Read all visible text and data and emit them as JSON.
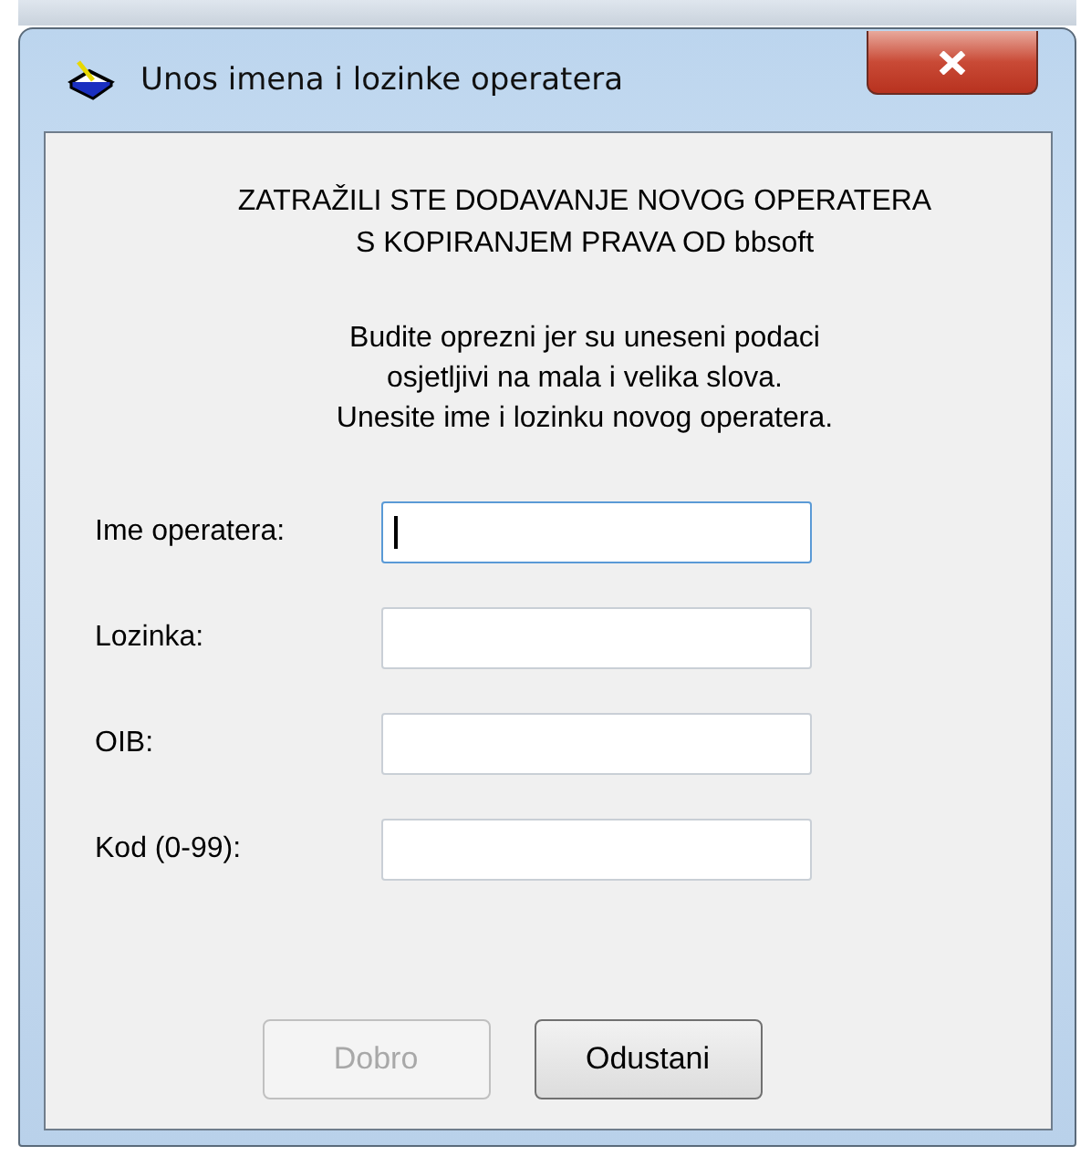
{
  "window": {
    "title": "Unos imena i lozinke operatera"
  },
  "heading": [
    "ZATRAŽILI STE DODAVANJE NOVOG OPERATERA",
    "S KOPIRANJEM PRAVA OD bbsoft"
  ],
  "notice": [
    "Budite oprezni jer su uneseni podaci",
    "osjetljivi na mala i velika slova.",
    "Unesite ime i lozinku novog operatera."
  ],
  "fields": [
    {
      "label": "Ime operatera:",
      "focused": true
    },
    {
      "label": "Lozinka:",
      "focused": false
    },
    {
      "label": "OIB:",
      "focused": false
    },
    {
      "label": "Kod (0-99):",
      "focused": false
    }
  ],
  "buttons": [
    {
      "label": "Dobro",
      "disabled": true
    },
    {
      "label": "Odustani",
      "disabled": false
    }
  ]
}
